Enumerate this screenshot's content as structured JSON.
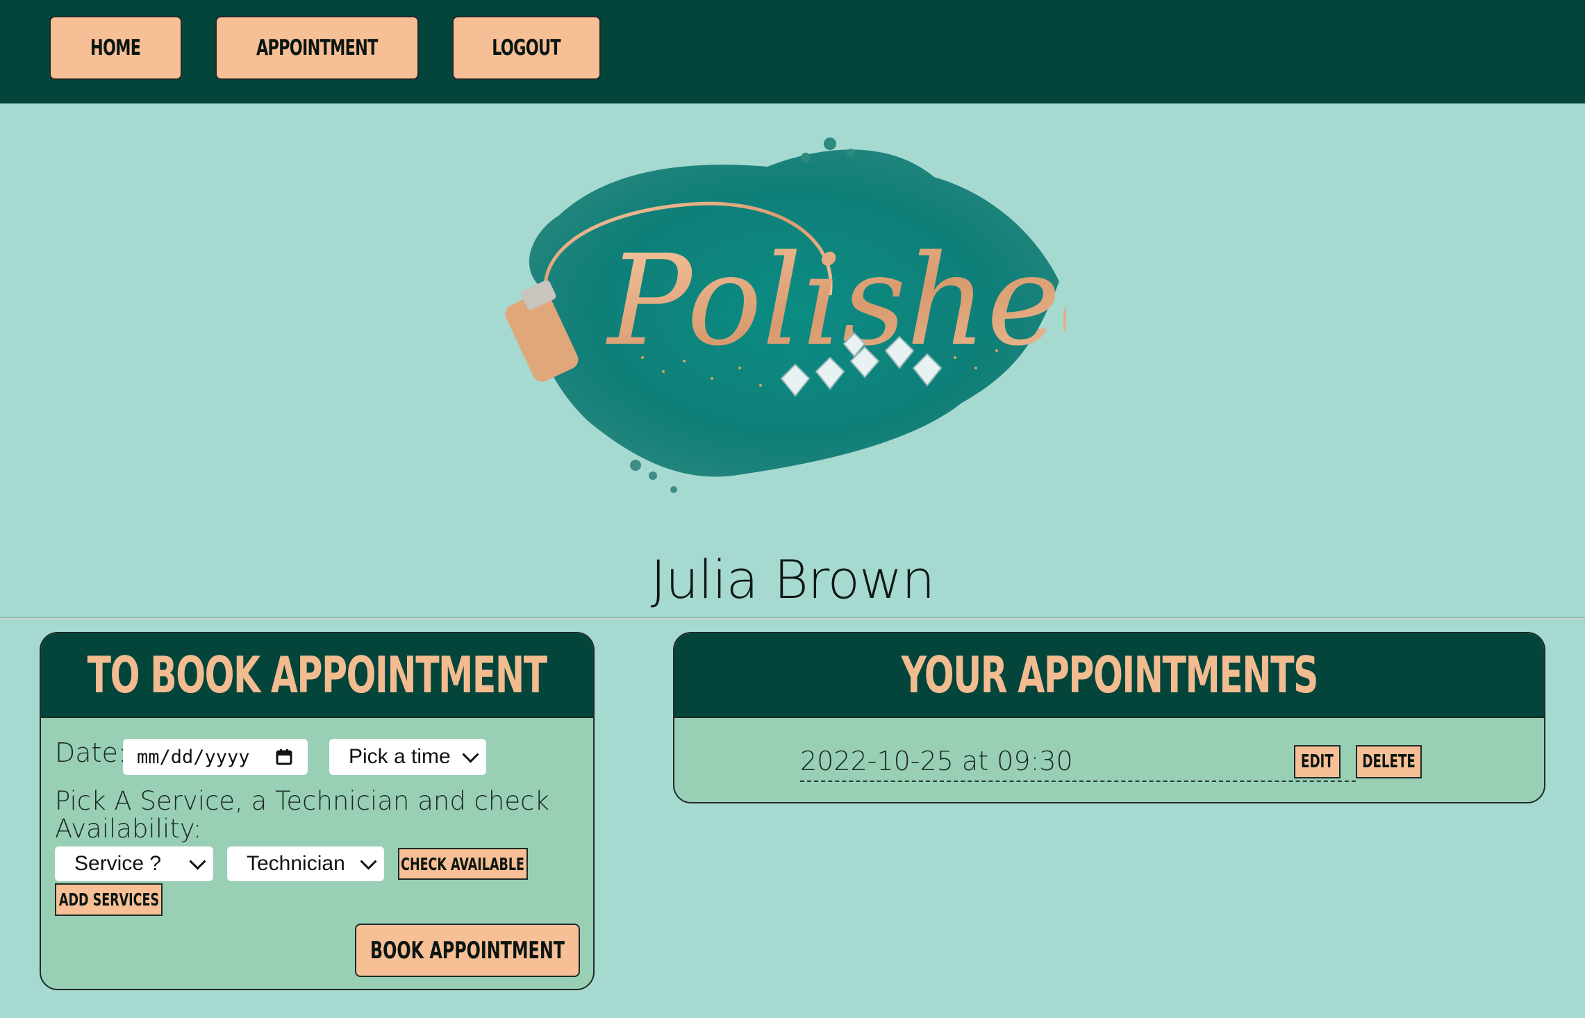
{
  "nav": {
    "home_label": "HOME",
    "appointment_label": "APPOINTMENT",
    "logout_label": "LOGOUT"
  },
  "logo": {
    "text": "Polished",
    "icon": "nail-polish-bottle-with-diamonds"
  },
  "user": {
    "name": "Julia Brown"
  },
  "book": {
    "title": "TO BOOK APPOINTMENT",
    "date_label": "Date:",
    "date_placeholder": "mm/dd/yyyy",
    "time_select": "Pick a time",
    "helper_text": "Pick A Service, a Technician and check Availability:",
    "service_select": "Service ?",
    "technician_select": "Technician",
    "check_button": "CHECK AVAILABLE",
    "add_services_button": "ADD SERVICES",
    "book_button": "BOOK APPOINTMENT"
  },
  "appointments": {
    "title": "YOUR APPOINTMENTS",
    "items": [
      {
        "text": "2022-10-25 at 09:30",
        "edit_label": "EDIT",
        "delete_label": "DELETE"
      }
    ]
  },
  "colors": {
    "header_bg": "#03453b",
    "page_bg": "#a6d9d0",
    "button_bg": "#f6bf95",
    "panel_bg": "#98cfb5",
    "heading_text": "#f3bb90",
    "logo_teal": "#0b8c83"
  }
}
